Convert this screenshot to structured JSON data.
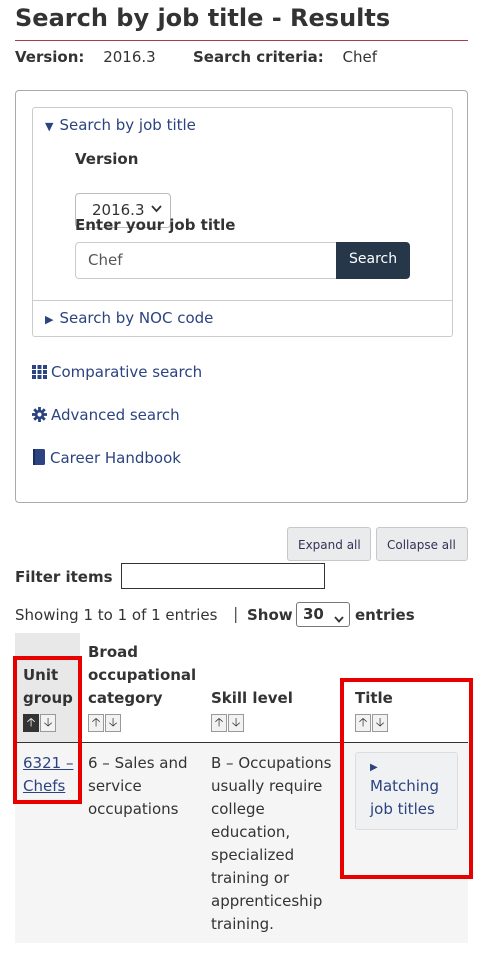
{
  "page": {
    "title": "Search by job title - Results",
    "version_label": "Version:",
    "version_value": "2016.3",
    "criteria_label": "Search criteria:",
    "criteria_value": "Chef"
  },
  "search_panel": {
    "by_title_summary": "Search by job title",
    "version_label": "Version",
    "version_selected": "2016.3",
    "job_title_label": "Enter your job title",
    "job_title_value": "Chef",
    "search_button": "Search",
    "by_noc_summary": "Search by NOC code"
  },
  "links": {
    "comparative": "Comparative search",
    "advanced": "Advanced search",
    "handbook": "Career Handbook"
  },
  "controls": {
    "expand_all": "Expand all",
    "collapse_all": "Collapse all",
    "filter_label": "Filter items",
    "showing": "Showing 1 to 1 of 1 entries",
    "separator": "|",
    "show_label": "Show",
    "show_value": "30",
    "entries_label": "entries"
  },
  "table": {
    "headers": {
      "unit_group_1": "Unit",
      "unit_group_2": "group",
      "broad_1": "Broad",
      "broad_2": "occupational",
      "broad_3": "category",
      "skill": "Skill level",
      "title": "Title"
    },
    "row": {
      "unit_1": "6321 –",
      "unit_2": "Chefs",
      "broad_1": "6 – Sales and",
      "broad_2": "service",
      "broad_3": "occupations",
      "skill_1": "B – Occupations",
      "skill_2": "usually require",
      "skill_3": "college",
      "skill_4": "education,",
      "skill_5": "specialized",
      "skill_6": "training or",
      "skill_7": "apprenticeship",
      "skill_8": "training.",
      "title_btn_1": "Matching",
      "title_btn_2": "job titles"
    }
  },
  "colors": {
    "link": "#2b4380",
    "primary_button": "#26374a",
    "highlight": "#e80000",
    "title_rule": "#af3c43"
  }
}
